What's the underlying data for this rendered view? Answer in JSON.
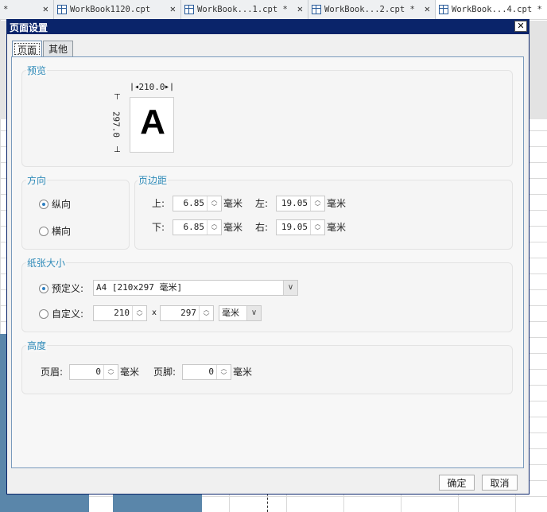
{
  "file_tabs": [
    {
      "label": "*",
      "active": false
    },
    {
      "label": "WorkBook1120.cpt",
      "active": false
    },
    {
      "label": "WorkBook...1.cpt *",
      "active": false
    },
    {
      "label": "WorkBook...2.cpt *",
      "active": false
    },
    {
      "label": "WorkBook...4.cpt *",
      "active": true
    }
  ],
  "dialog": {
    "title": "页面设置",
    "close_glyph": "✕",
    "tabs": [
      {
        "label": "页面",
        "active": true
      },
      {
        "label": "其他",
        "active": false
      }
    ],
    "preview": {
      "title": "预览",
      "width_label": "210.0",
      "height_label": "297.0",
      "letter": "A"
    },
    "orientation": {
      "title": "方向",
      "options": [
        {
          "label": "纵向",
          "selected": true
        },
        {
          "label": "横向",
          "selected": false
        }
      ]
    },
    "margins": {
      "title": "页边距",
      "top_label": "上:",
      "top_value": "6.85",
      "bottom_label": "下:",
      "bottom_value": "6.85",
      "left_label": "左:",
      "left_value": "19.05",
      "right_label": "右:",
      "right_value": "19.05",
      "unit": "毫米"
    },
    "paper_size": {
      "title": "纸张大小",
      "predefined_label": "预定义:",
      "predefined_value": "A4 [210x297 毫米]",
      "predefined_selected": true,
      "custom_label": "自定义:",
      "custom_width": "210",
      "custom_x": "x",
      "custom_height": "297",
      "custom_unit": "毫米"
    },
    "height": {
      "title": "高度",
      "header_label": "页眉:",
      "header_value": "0",
      "footer_label": "页脚:",
      "footer_value": "0",
      "unit": "毫米"
    },
    "ok_label": "确定",
    "cancel_label": "取消"
  },
  "colors": {
    "title_bar": "#0a246a",
    "group_title": "#2e8ab8",
    "panel_border": "#7a9bbd",
    "sheet_blue": "#5a86aa"
  }
}
